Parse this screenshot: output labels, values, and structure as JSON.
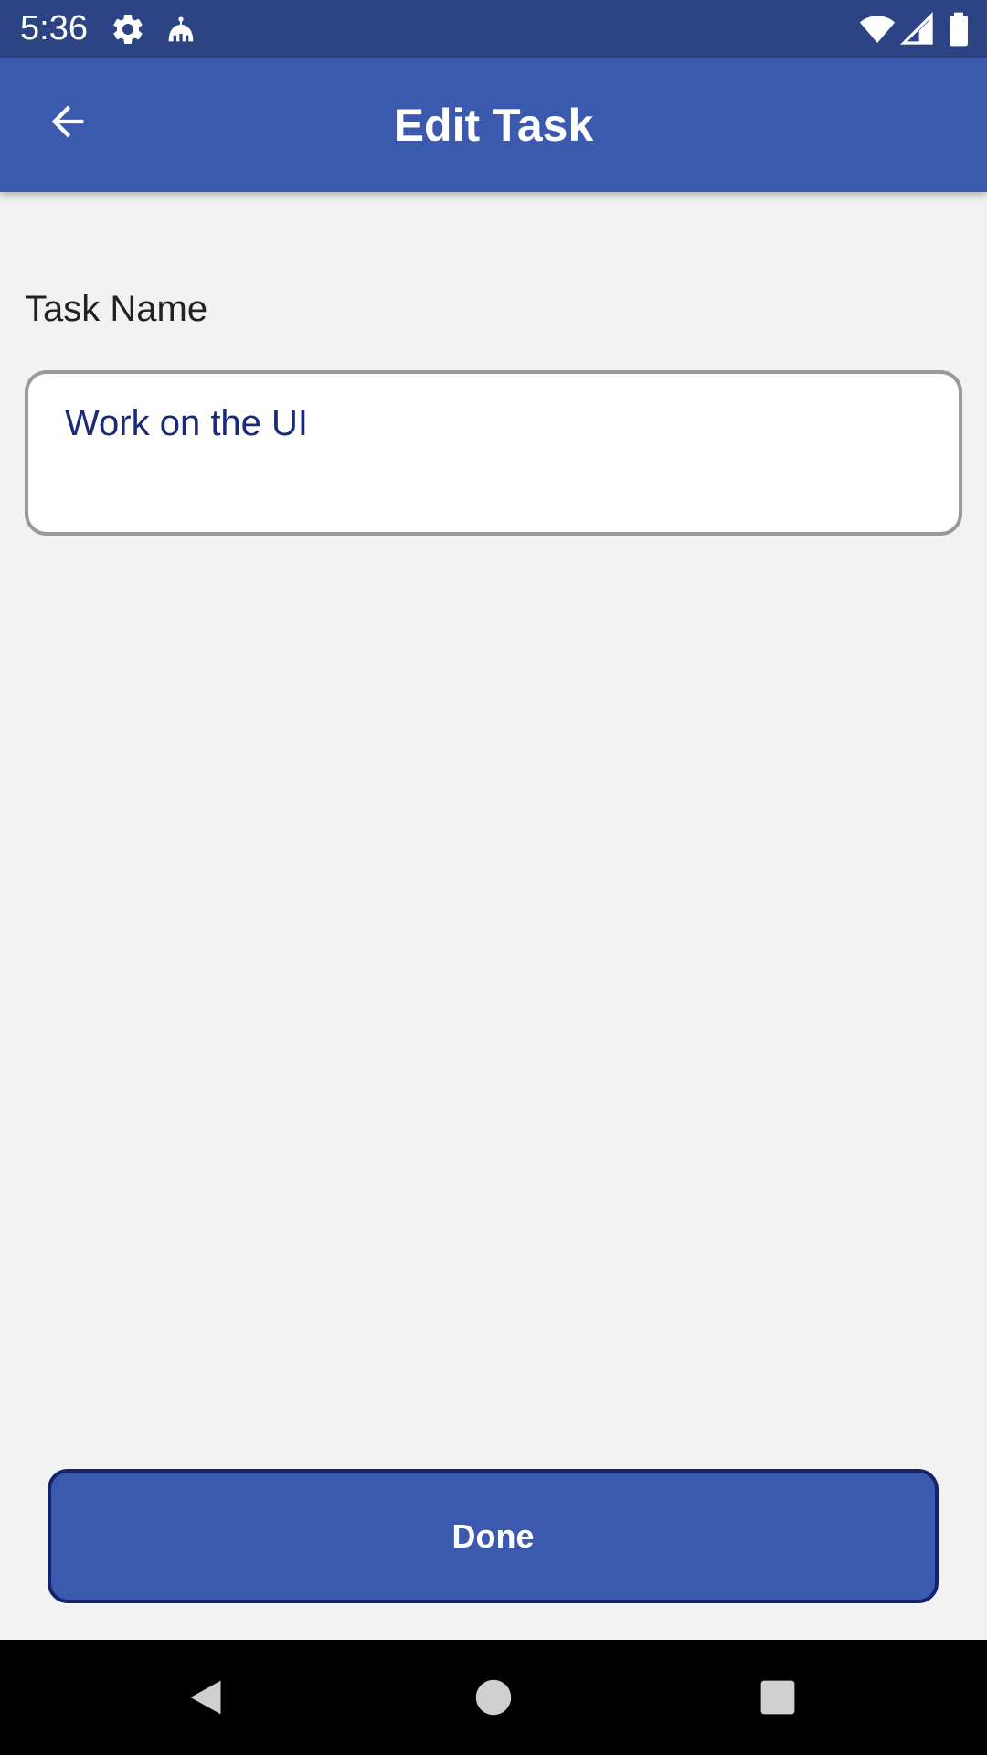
{
  "status_bar": {
    "time": "5:36",
    "icons": [
      "gear-icon",
      "android-debug-icon",
      "wifi-icon",
      "cellular-signal-icon",
      "battery-icon"
    ]
  },
  "app_bar": {
    "title": "Edit Task",
    "back_icon": "arrow-back-icon"
  },
  "form": {
    "task_name_label": "Task Name",
    "task_name_value": "Work on the UI"
  },
  "actions": {
    "done_label": "Done"
  },
  "nav_bar": {
    "icons": [
      "back-triangle-icon",
      "home-circle-icon",
      "recents-square-icon"
    ]
  },
  "colors": {
    "status_bar": "#2c4484",
    "app_bar": "#3b5aae",
    "background": "#f2f2f2",
    "input_text": "#1a2a78",
    "button_border": "#15246a"
  }
}
